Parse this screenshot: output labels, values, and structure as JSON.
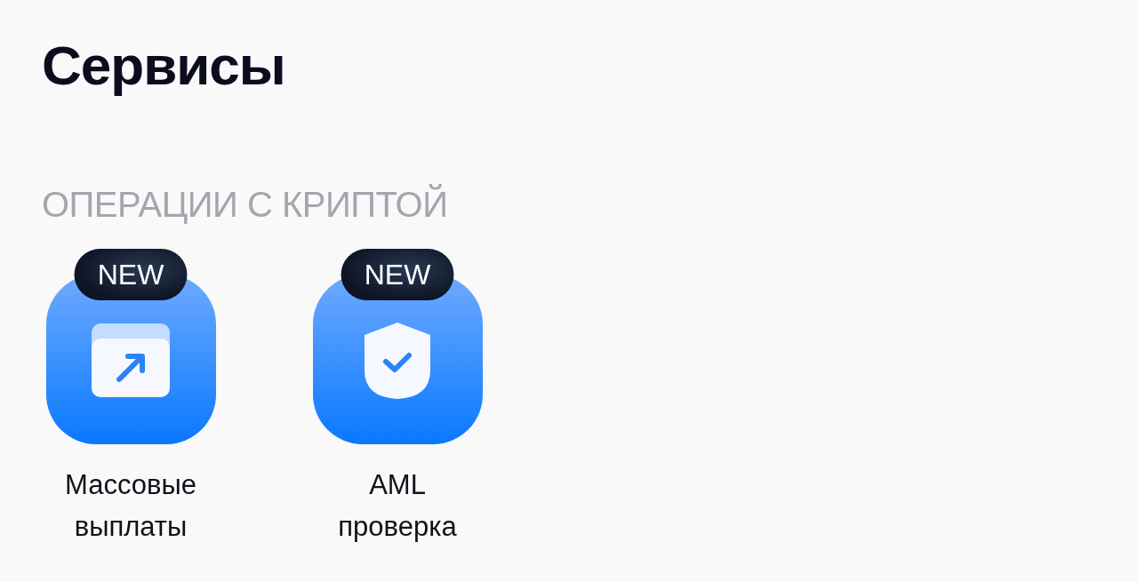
{
  "title": "Сервисы",
  "section": {
    "title": "ОПЕРАЦИИ С КРИПТОЙ",
    "services": [
      {
        "kind": "payouts",
        "badge": "NEW",
        "label": "Массовые выплаты"
      },
      {
        "kind": "aml",
        "badge": "NEW",
        "label": "AML проверка"
      }
    ]
  }
}
